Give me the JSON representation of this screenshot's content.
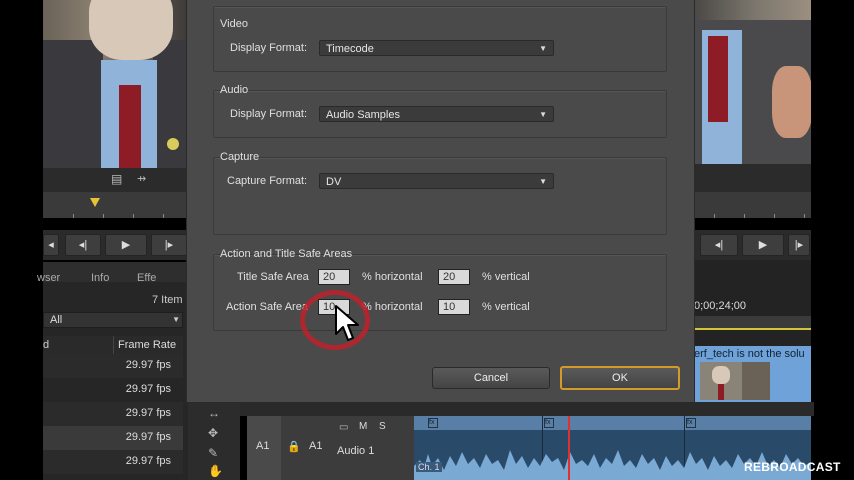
{
  "dialog": {
    "video": {
      "title": "Video",
      "display_format_label": "Display Format:",
      "display_format_value": "Timecode"
    },
    "audio": {
      "title": "Audio",
      "display_format_label": "Display Format:",
      "display_format_value": "Audio Samples"
    },
    "capture": {
      "title": "Capture",
      "capture_format_label": "Capture Format:",
      "capture_format_value": "DV"
    },
    "safe_areas": {
      "title": "Action and Title Safe Areas",
      "title_safe_label": "Title Safe Area",
      "title_safe_h": "20",
      "title_safe_v": "20",
      "action_safe_label": "Action Safe Area",
      "action_safe_h": "10",
      "action_safe_v": "10",
      "pct_horizontal": "% horizontal",
      "pct_vertical": "% vertical"
    },
    "buttons": {
      "cancel": "Cancel",
      "ok": "OK"
    }
  },
  "project_panel": {
    "tabs": [
      "wser",
      "Info",
      "Effe"
    ],
    "items_count": "7 Item",
    "filter": "All",
    "col_name": "d",
    "col_frame_rate": "Frame Rate",
    "rows": [
      "29.97 fps",
      "29.97 fps",
      "29.97 fps",
      "29.97 fps",
      "29.97 fps"
    ]
  },
  "program_monitor": {
    "timecode": "0;00;24;00",
    "caption": "erf_tech is not the solu"
  },
  "timeline": {
    "track_left": "A1",
    "track_name": "A1",
    "m": "M",
    "s": "S",
    "audio_name": "Audio 1",
    "channel_label": "Ch. 1"
  },
  "watermark": "REBROADCAST",
  "colors": {
    "dialog_bg": "#4a4a4a",
    "ok_border": "#d39b2a",
    "click_ring": "#c0202a"
  }
}
